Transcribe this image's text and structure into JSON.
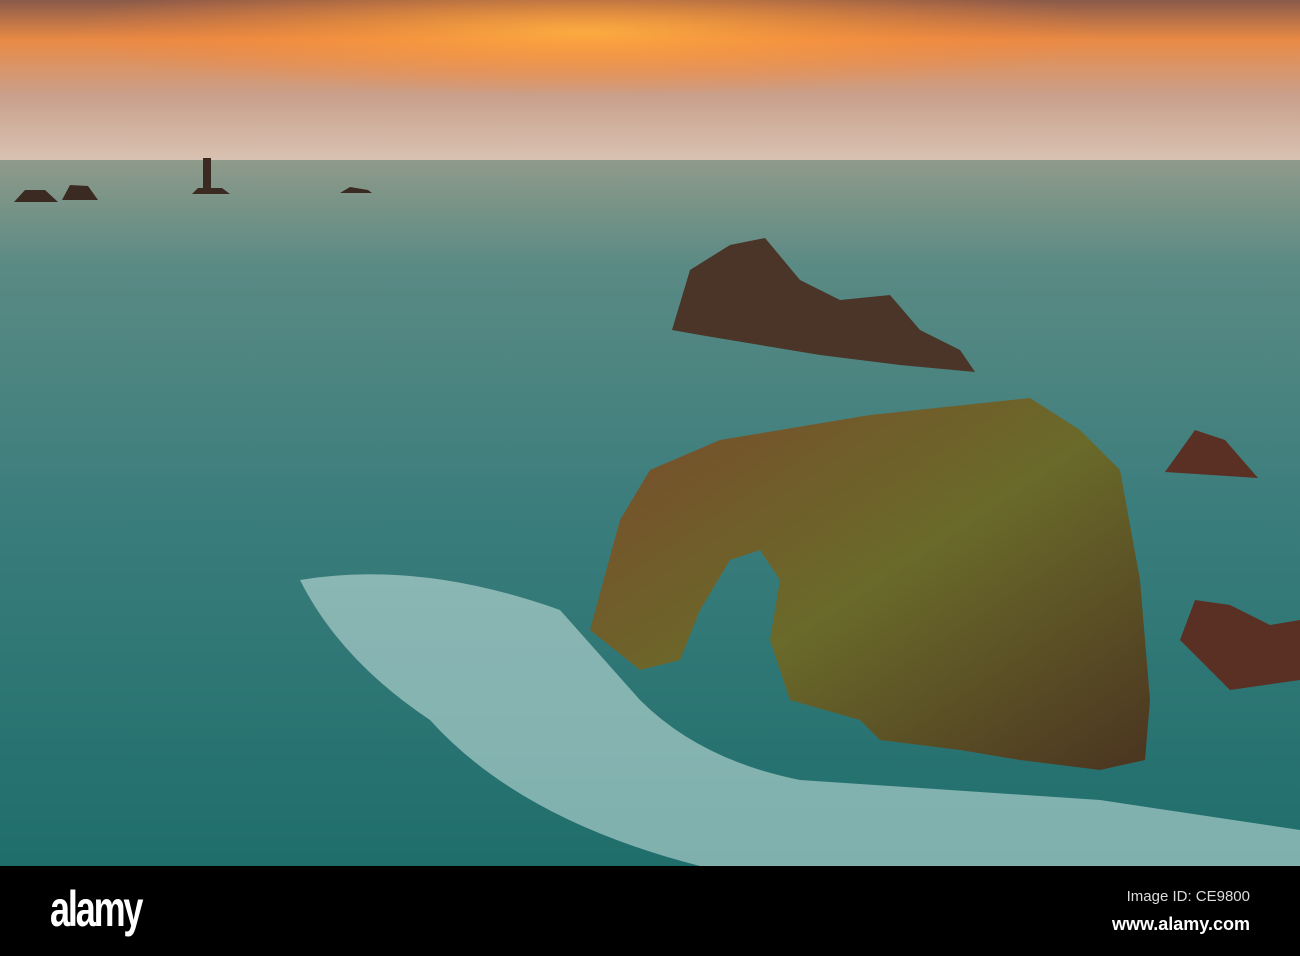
{
  "watermark": {
    "logo": "alamy",
    "image_id": "Image ID: CE9800",
    "website": "www.alamy.com"
  },
  "colors": {
    "sky_glow": "#f08a3a",
    "sea": "#2f7a78",
    "rock": "#6a4128",
    "moss": "#6d7a2a"
  }
}
